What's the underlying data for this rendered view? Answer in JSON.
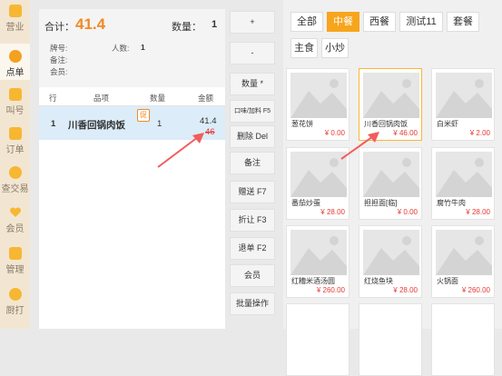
{
  "nav": {
    "items": [
      {
        "label": "营业",
        "icon": "store-icon"
      },
      {
        "label": "点单",
        "icon": "hand-pointer-icon"
      },
      {
        "label": "叫号",
        "icon": "ticket-icon"
      },
      {
        "label": "订单",
        "icon": "order-list-icon"
      },
      {
        "label": "查交易",
        "icon": "coin-icon"
      },
      {
        "label": "会员",
        "icon": "heart-icon"
      },
      {
        "label": "管理",
        "icon": "grid-icon"
      },
      {
        "label": "厨打",
        "icon": "printer-icon"
      }
    ],
    "active_index": 1
  },
  "order": {
    "total_label": "合计：",
    "total_value": "41.4",
    "qty_label": "数量：",
    "qty_value": "1",
    "table_label": "牌号:",
    "people_label": "人数:",
    "people_value": "1",
    "note_label": "备注:",
    "member_label": "会员:",
    "columns": [
      "行",
      "品项",
      "数量",
      "金额"
    ],
    "rows": [
      {
        "line": "1",
        "name": "川香回锅肉饭",
        "promo": "促",
        "qty": "1",
        "amount": "41.4",
        "original": "46"
      }
    ]
  },
  "actions": [
    {
      "label": "+",
      "name": "plus-button"
    },
    {
      "label": "-",
      "name": "minus-button"
    },
    {
      "label": "数量 *",
      "name": "quantity-button"
    },
    {
      "label": "口味/加料 F5",
      "name": "flavor-button",
      "small": true
    },
    {
      "label": "删除 Del",
      "name": "delete-button"
    },
    {
      "label": "备注",
      "name": "note-button"
    },
    {
      "label": "赠送 F7",
      "name": "gift-button"
    },
    {
      "label": "折让 F3",
      "name": "discount-button"
    },
    {
      "label": "退单 F2",
      "name": "refund-button"
    },
    {
      "label": "会员",
      "name": "member-button"
    },
    {
      "label": "批量操作",
      "name": "batch-button"
    }
  ],
  "categories": [
    {
      "label": "全部"
    },
    {
      "label": "中餐",
      "active": true
    },
    {
      "label": "西餐"
    },
    {
      "label": "测试11"
    },
    {
      "label": "套餐"
    },
    {
      "label": "主食"
    },
    {
      "label": "小炒"
    }
  ],
  "dishes": [
    {
      "name": "葱花饼",
      "price": "¥ 0.00"
    },
    {
      "name": "川香回锅肉饭",
      "price": "¥ 46.00",
      "active": true
    },
    {
      "name": "白米虾",
      "price": "¥ 2.00"
    },
    {
      "name": "番茄炒蛋",
      "price": "¥ 28.00"
    },
    {
      "name": "担担面[临]",
      "price": "¥ 0.00"
    },
    {
      "name": "腐竹牛肉",
      "price": "¥ 28.00"
    },
    {
      "name": "红糟米酒汤圆",
      "price": "¥ 260.00"
    },
    {
      "name": "红烧鱼块",
      "price": "¥ 28.00"
    },
    {
      "name": "火锅面",
      "price": "¥ 260.00"
    }
  ],
  "colors": {
    "accent": "#f7a51c",
    "price": "#e53935",
    "selected_row": "#dcecf9",
    "total": "#f08a24"
  }
}
